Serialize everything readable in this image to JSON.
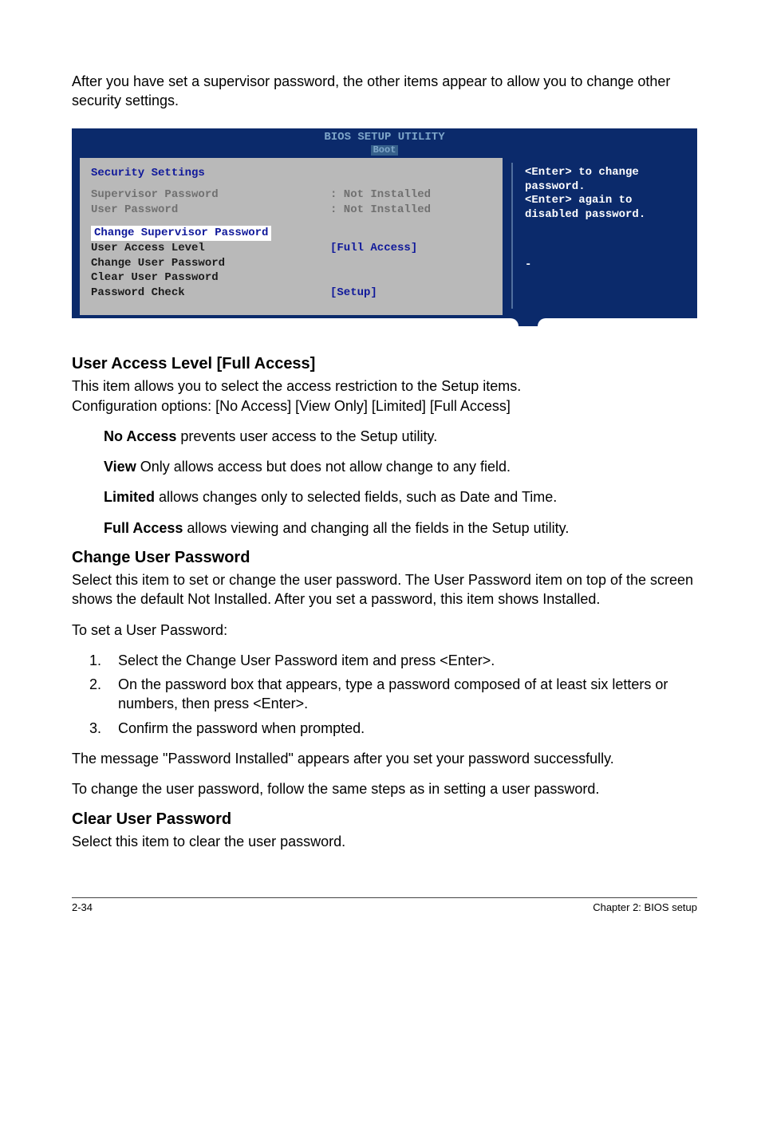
{
  "intro": "After you have set a supervisor password, the other items appear to allow you to change other security settings.",
  "bios": {
    "title": "BIOS SETUP UTILITY",
    "tab": "Boot",
    "panel": {
      "heading": "Security Settings",
      "rows_dim": [
        {
          "label": "Supervisor Password",
          "value": ": Not Installed"
        },
        {
          "label": "User Password",
          "value": ": Not Installed"
        }
      ],
      "highlight": "Change Supervisor Password",
      "rows_active": [
        {
          "label": "User Access Level",
          "value": "[Full Access]"
        },
        {
          "label": "Change User Password",
          "value": ""
        },
        {
          "label": "Clear User Password",
          "value": ""
        },
        {
          "label": "Password Check",
          "value": "[Setup]"
        }
      ]
    },
    "help": {
      "line1": "<Enter> to change password.",
      "line2": "<Enter> again to disabled password."
    }
  },
  "ual": {
    "heading": "User Access Level [Full Access]",
    "p1": "This item allows you to select the access restriction to the Setup items.",
    "p2": "Configuration options: [No Access] [View Only] [Limited] [Full Access]",
    "li1_b": "No Access",
    "li1_t": " prevents user access to the Setup utility.",
    "li2_b": "View",
    "li2_t": " Only allows access but does not allow change to any field.",
    "li3_b": "Limited",
    "li3_t": " allows changes only to selected fields, such as Date and Time.",
    "li4_b": "Full Access",
    "li4_t": " allows viewing and changing all the fields in the Setup utility."
  },
  "cup": {
    "heading": "Change User Password",
    "p1": "Select this item to set or change the user password. The User Password item on top of the screen shows the default Not Installed. After you set a password, this item shows Installed.",
    "p2": "To set a User Password:",
    "steps": [
      "Select the Change User Password item and press <Enter>.",
      "On the password box that appears, type a password composed of at least six letters or numbers, then press <Enter>.",
      "Confirm the password when prompted."
    ],
    "p3": "The message \"Password Installed\" appears after you set your password successfully.",
    "p4": "To change the user password, follow the same steps as in setting a user password."
  },
  "clp": {
    "heading": "Clear User Password",
    "p1": "Select this item to clear the user password."
  },
  "footer": {
    "left": "2-34",
    "right": "Chapter 2: BIOS setup"
  }
}
